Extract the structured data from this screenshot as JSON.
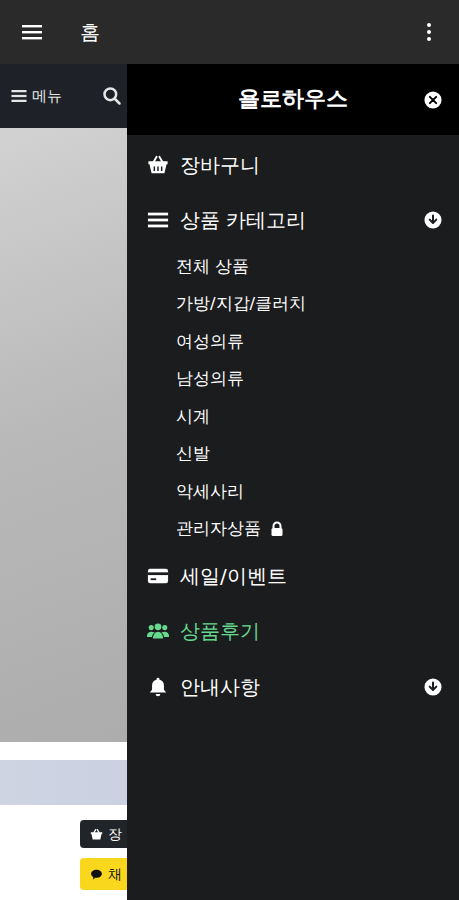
{
  "app_bar": {
    "title": "홈"
  },
  "page": {
    "menu_label": "메뉴",
    "actions": [
      {
        "label": "장"
      },
      {
        "label": "채"
      }
    ]
  },
  "drawer": {
    "title": "욜로하우스",
    "items": [
      {
        "label": "장바구니",
        "kind": "link",
        "selected": false
      },
      {
        "label": "상품 카테고리",
        "kind": "group",
        "selected": false,
        "expanded": true,
        "children": [
          {
            "label": "전체 상품",
            "locked": false
          },
          {
            "label": "가방/지갑/클러치",
            "locked": false
          },
          {
            "label": "여성의류",
            "locked": false
          },
          {
            "label": "남성의류",
            "locked": false
          },
          {
            "label": "시계",
            "locked": false
          },
          {
            "label": "신발",
            "locked": false
          },
          {
            "label": "악세사리",
            "locked": false
          },
          {
            "label": "관리자상품",
            "locked": true
          }
        ]
      },
      {
        "label": "세일/이벤트",
        "kind": "link",
        "selected": false
      },
      {
        "label": "상품후기",
        "kind": "link",
        "selected": true
      },
      {
        "label": "안내사항",
        "kind": "group",
        "selected": false,
        "expanded": false,
        "children": []
      }
    ]
  }
}
